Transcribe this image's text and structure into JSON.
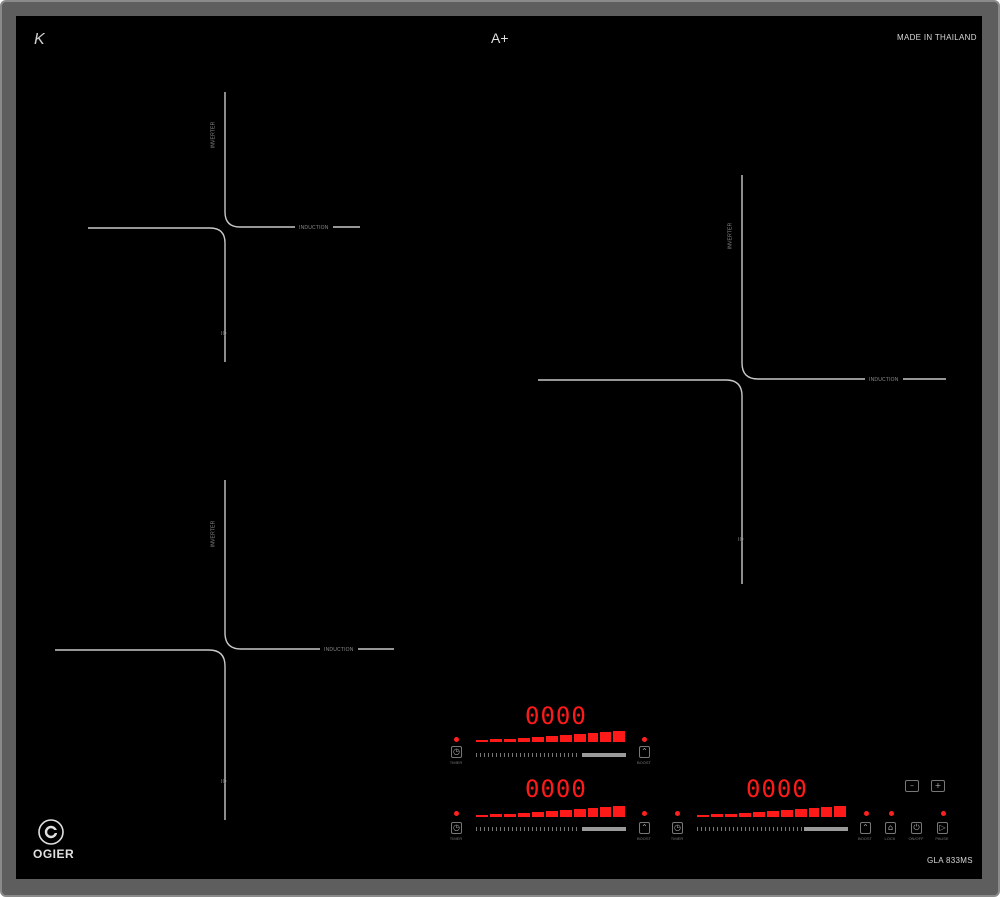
{
  "hob": {
    "brand_mark": "K",
    "energy_class": "A+",
    "origin": "MADE IN THAILAND",
    "brand": "OGIER",
    "model": "GLA 833MS"
  },
  "zones": [
    {
      "vertical_label": "INVERTER",
      "horizontal_label": "INDUCTION",
      "bottom_label": "IQ"
    },
    {
      "vertical_label": "INVERTER",
      "horizontal_label": "INDUCTION",
      "bottom_label": "IQ"
    },
    {
      "vertical_label": "INVERTER",
      "horizontal_label": "INDUCTION",
      "bottom_label": "IQ"
    }
  ],
  "controls": {
    "display_1": "0000",
    "display_2": "0000",
    "display_3": "0000",
    "min_symbol": "–",
    "plus_symbol": "+",
    "timer_label": "TIMER",
    "boost_label": "BOOST",
    "lock_label": "LOCK",
    "power_label": "ON/OFF",
    "pause_label": "PAUSE"
  },
  "accent_color": "#ff1a1a"
}
